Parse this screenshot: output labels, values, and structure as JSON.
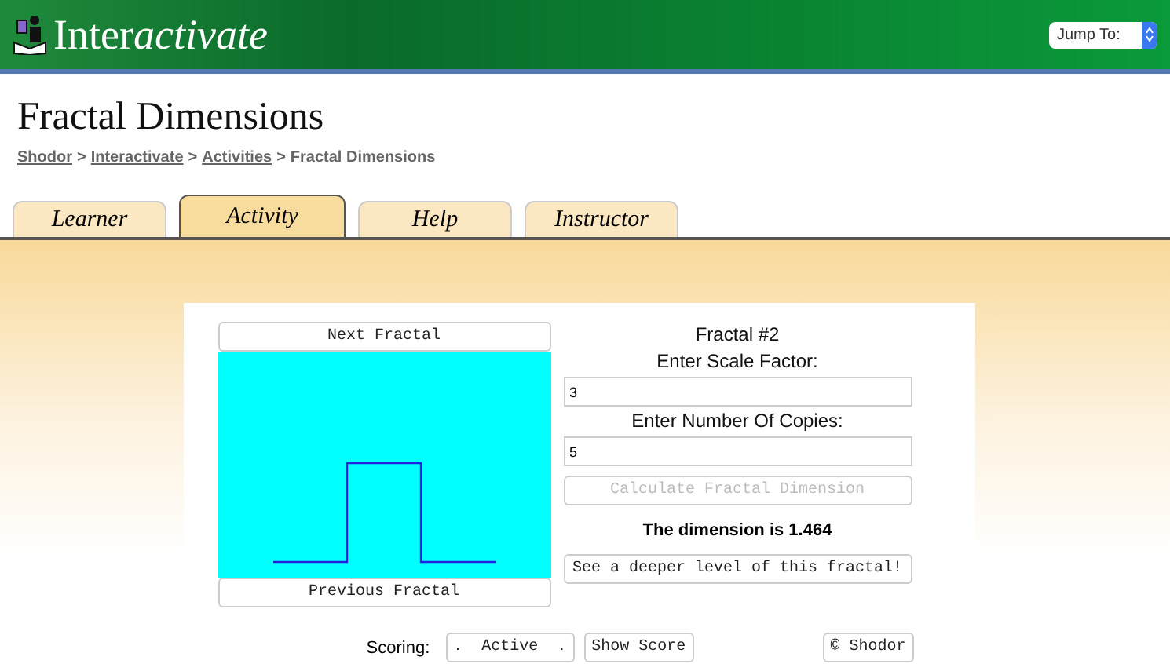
{
  "header": {
    "logo_bold": "Inter",
    "logo_italic": "activate",
    "jump_menu": {
      "label": "Jump To:"
    }
  },
  "page_title": "Fractal Dimensions",
  "breadcrumb": [
    {
      "label": "Shodor",
      "link": true
    },
    {
      "label": "Interactivate",
      "link": true
    },
    {
      "label": "Activities",
      "link": true
    },
    {
      "label": "Fractal Dimensions",
      "link": false
    }
  ],
  "breadcrumb_separator": ">",
  "tabs": [
    {
      "label": "Learner",
      "selected": false
    },
    {
      "label": "Activity",
      "selected": true
    },
    {
      "label": "Help",
      "selected": false
    },
    {
      "label": "Instructor",
      "selected": false
    }
  ],
  "applet": {
    "next_button": "Next Fractal",
    "previous_button": "Previous Fractal",
    "fractal_title": "Fractal #2",
    "scale_label": "Enter Scale Factor:",
    "scale_value": "3",
    "copies_label": "Enter Number Of Copies:",
    "copies_value": "5",
    "calculate_button": {
      "label": "Calculate Fractal Dimension",
      "disabled": true
    },
    "result": "The dimension is 1.464",
    "deeper_button": {
      "label": "See a deeper level of this fractal!",
      "disabled": false
    }
  },
  "footer": {
    "scoring_label": "Scoring:",
    "scoring_button": ".  Active  .",
    "show_score_button": "Show Score",
    "credit_button": "© Shodor"
  }
}
